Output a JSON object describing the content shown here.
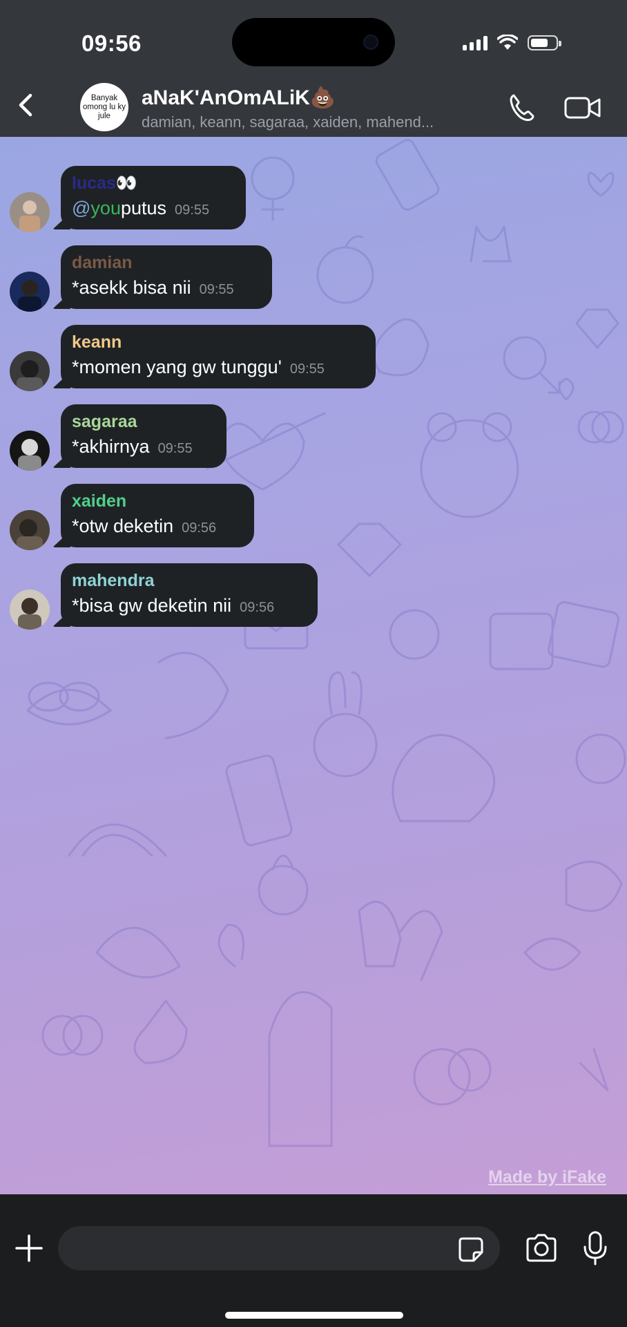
{
  "status_bar": {
    "time": "09:56"
  },
  "header": {
    "group_avatar_text": "Banyak omong lu ky jule",
    "title": "aNaK'AnOmALiK💩",
    "subtitle": "damian, keann, sagaraa, xaiden, mahend..."
  },
  "messages": [
    {
      "sender": "lucas👀",
      "sender_color": "#2a2a8a",
      "mention": "@",
      "mention_you": "you",
      "text": " putus",
      "time": "09:55"
    },
    {
      "sender": "damian",
      "sender_color": "#7a5a45",
      "mention": "",
      "mention_you": "",
      "text": "*asekk bisa nii",
      "time": "09:55"
    },
    {
      "sender": "keann",
      "sender_color": "#f0c98a",
      "mention": "",
      "mention_you": "",
      "text": "*momen yang gw tunggu'",
      "time": "09:55"
    },
    {
      "sender": "sagaraa",
      "sender_color": "#a8d89a",
      "mention": "",
      "mention_you": "",
      "text": "*akhirnya",
      "time": "09:55"
    },
    {
      "sender": "xaiden",
      "sender_color": "#4fd08a",
      "mention": "",
      "mention_you": "",
      "text": "*otw deketin",
      "time": "09:56"
    },
    {
      "sender": "mahendra",
      "sender_color": "#8fd3d6",
      "mention": "",
      "mention_you": "",
      "text": "*bisa gw deketin nii",
      "time": "09:56"
    }
  ],
  "watermark": "Made by iFake",
  "input": {
    "value": "",
    "placeholder": ""
  },
  "icons": {
    "back": "chevron-left-icon",
    "call": "phone-icon",
    "video": "video-camera-icon",
    "add": "plus-icon",
    "sticker": "sticker-icon",
    "camera": "camera-icon",
    "mic": "microphone-icon"
  },
  "colors": {
    "bubble": "#1f2225",
    "header": "#34373c",
    "bottom_bar": "#1c1d1f",
    "mention_you": "#3ab65c"
  }
}
